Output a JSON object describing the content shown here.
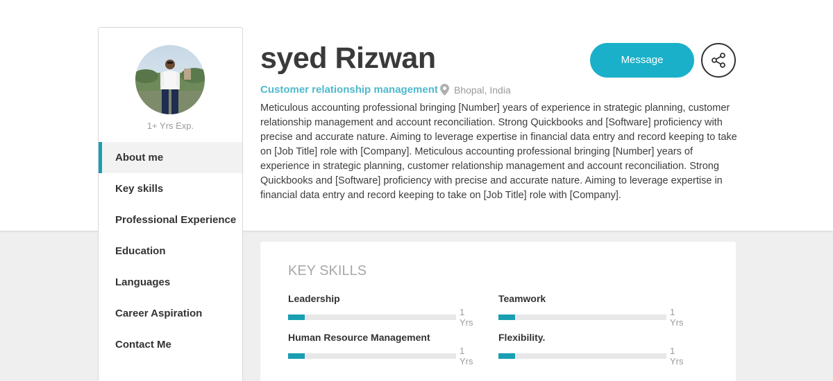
{
  "profile": {
    "name": "syed Rizwan",
    "role": "Customer relationship management",
    "location": "Bhopal, India",
    "experience": "1+ Yrs Exp.",
    "bio": "Meticulous accounting professional bringing [Number] years of experience in strategic planning, customer relationship management and account reconciliation. Strong Quickbooks and [Software] proficiency with precise and accurate nature. Aiming to leverage expertise in financial data entry and record keeping to take on [Job Title] role with [Company]. Meticulous accounting professional bringing [Number] years of experience in strategic planning, customer relationship management and account reconciliation. Strong Quickbooks and [Software] proficiency with precise and accurate nature. Aiming to leverage expertise in financial data entry and record keeping to take on [Job Title] role with [Company]."
  },
  "actions": {
    "message_label": "Message",
    "share_icon": "share-icon"
  },
  "sidebar": {
    "active_index": 0,
    "items": [
      {
        "label": "About me"
      },
      {
        "label": "Key skills"
      },
      {
        "label": "Professional Experience"
      },
      {
        "label": "Education"
      },
      {
        "label": "Languages"
      },
      {
        "label": "Career Aspiration"
      },
      {
        "label": "Contact Me"
      }
    ]
  },
  "key_skills": {
    "title": "KEY SKILLS",
    "skills": [
      {
        "name": "Leadership",
        "years": "1 Yrs",
        "level": 0.1
      },
      {
        "name": "Teamwork",
        "years": "1 Yrs",
        "level": 0.1
      },
      {
        "name": "Human Resource Management",
        "years": "1 Yrs",
        "level": 0.1
      },
      {
        "name": "Flexibility.",
        "years": "1 Yrs",
        "level": 0.1
      }
    ]
  },
  "colors": {
    "accent": "#1ab0c9",
    "role_text": "#4fb9cc",
    "bar_fill": "#1a9fb2",
    "page_bg": "#efefef"
  }
}
